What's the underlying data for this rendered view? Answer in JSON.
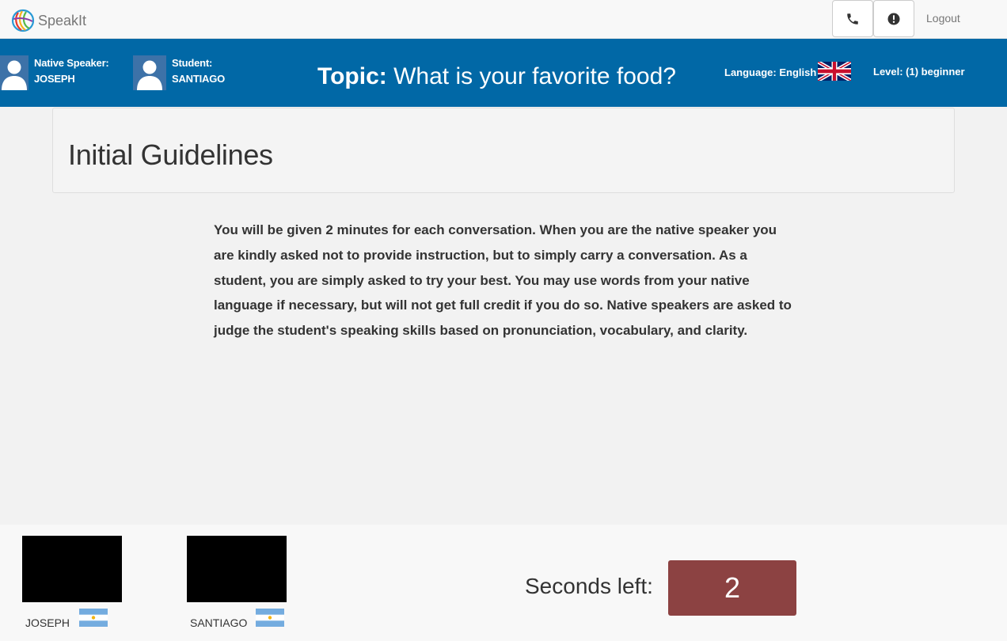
{
  "app": {
    "name": "SpeakIt"
  },
  "nav": {
    "logout_label": "Logout",
    "call_icon": "phone-icon",
    "alert_icon": "exclamation-circle-icon"
  },
  "banner": {
    "native": {
      "role": "Native Speaker:",
      "name": "JOSEPH"
    },
    "student": {
      "role": "Student:",
      "name": "SANTIAGO"
    },
    "topic_label": "Topic:",
    "topic_text": "What is your favorite food?",
    "language_label": "Language: English",
    "level_label": "Level: (1) beginner",
    "bg_color": "#0168a6"
  },
  "main": {
    "heading": "Initial Guidelines",
    "body": "You will be given 2 minutes for each conversation. When you are the native speaker you are kindly asked not to provide instruction, but to simply carry a conversation. As a student, you are simply asked to try your best. You may use words from your native language if necessary, but will not get full credit if you do so. Native speakers are asked to judge the student's speaking skills based on pronunciation, vocabulary, and clarity."
  },
  "footer": {
    "participants": [
      {
        "name": "JOSEPH",
        "flag": "argentina-flag-icon"
      },
      {
        "name": "SANTIAGO",
        "flag": "argentina-flag-icon"
      }
    ],
    "seconds_label": "Seconds left:",
    "seconds_value": "2",
    "timer_color": "#8c4242"
  }
}
